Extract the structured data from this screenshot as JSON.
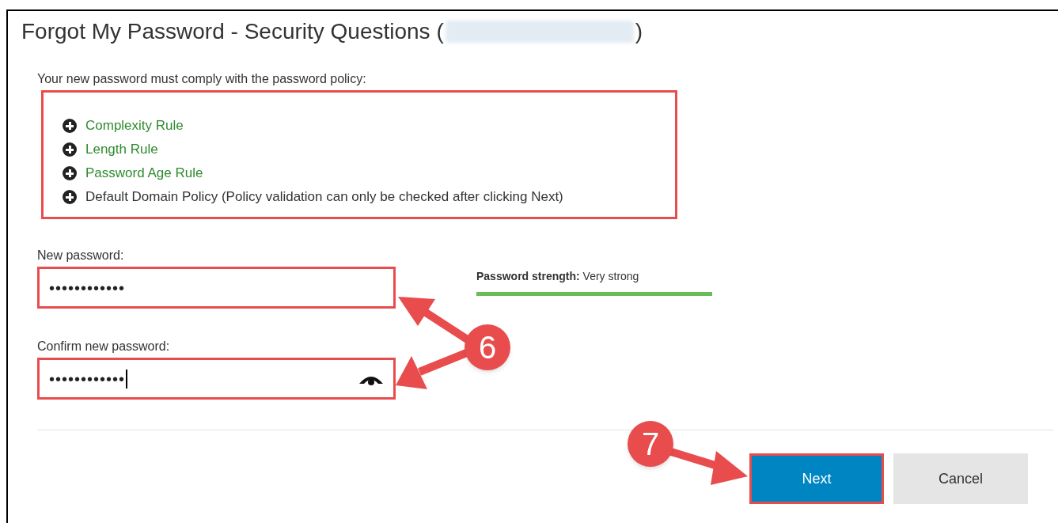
{
  "title": {
    "prefix": "Forgot My Password - Security Questions (",
    "suffix": ")",
    "redacted": true
  },
  "policy": {
    "intro": "Your new password must comply with the password policy:",
    "highlighted": true,
    "items": [
      {
        "label": "Complexity Rule",
        "link": true
      },
      {
        "label": "Length Rule",
        "link": true
      },
      {
        "label": "Password Age Rule",
        "link": true
      },
      {
        "label": "Default Domain Policy (Policy validation can only be checked after clicking Next)",
        "link": false
      }
    ]
  },
  "fields": [
    {
      "label": "New password:",
      "value": "••••••••••••",
      "highlighted": true,
      "focused": false,
      "reveal_icon": false
    },
    {
      "label": "Confirm new password:",
      "value": "••••••••••••",
      "highlighted": true,
      "focused": true,
      "reveal_icon": true
    }
  ],
  "strength": {
    "label": "Password strength:",
    "value": "Very strong",
    "level": 1
  },
  "buttons": [
    {
      "label": "Next",
      "kind": "primary",
      "highlighted": true
    },
    {
      "label": "Cancel",
      "kind": "secondary",
      "highlighted": false
    }
  ],
  "callouts": [
    {
      "label": "6"
    },
    {
      "label": "7"
    }
  ]
}
